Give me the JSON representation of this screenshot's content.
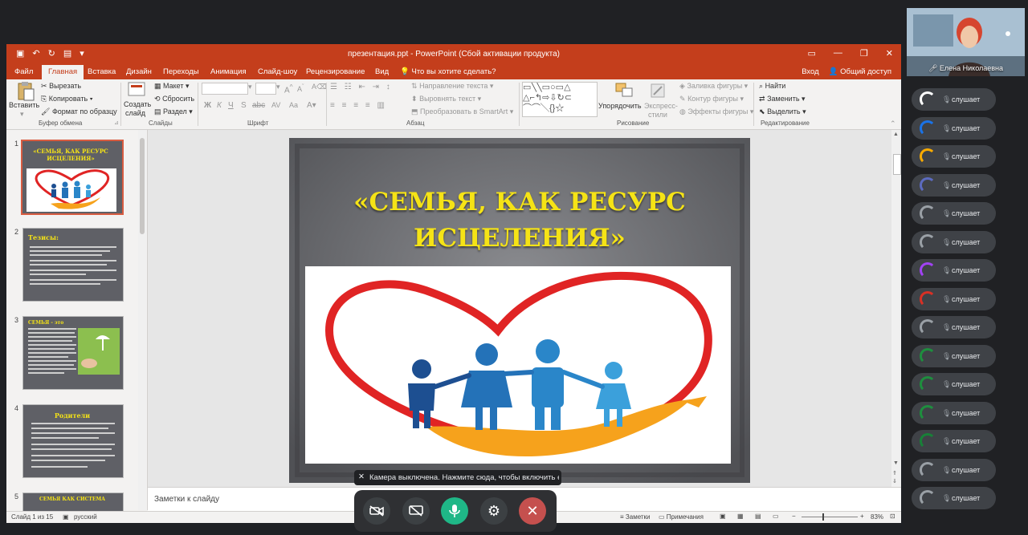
{
  "ppt": {
    "window_title": "презентация.ppt - PowerPoint (Сбой активации продукта)",
    "tabs": [
      "Файл",
      "Главная",
      "Вставка",
      "Дизайн",
      "Переходы",
      "Анимация",
      "Слайд-шоу",
      "Рецензирование",
      "Вид"
    ],
    "tell_me": "Что вы хотите сделать?",
    "sign_in": "Вход",
    "share": "Общий доступ",
    "ribbon": {
      "paste": "Вставить",
      "cut": "Вырезать",
      "copy": "Копировать",
      "format_painter": "Формат по образцу",
      "clipboard_group": "Буфер обмена",
      "new_slide_line1": "Создать",
      "new_slide_line2": "слайд",
      "layout": "Макет",
      "reset": "Сбросить",
      "section": "Раздел",
      "slides_group": "Слайды",
      "font_group": "Шрифт",
      "text_direction": "Направление текста",
      "align_text": "Выровнять текст",
      "smartart": "Преобразовать в SmartArt",
      "paragraph_group": "Абзац",
      "arrange": "Упорядочить",
      "quick_styles_line1": "Экспресс-",
      "quick_styles_line2": "стили",
      "shape_fill": "Заливка фигуры",
      "shape_outline": "Контур фигуры",
      "shape_effects": "Эффекты фигуры",
      "drawing_group": "Рисование",
      "find": "Найти",
      "replace": "Заменить",
      "select": "Выделить",
      "editing_group": "Редактирование"
    },
    "thumbnails": [
      {
        "num": "1",
        "title": "«СЕМЬЯ, КАК РЕСУРС ИСЦЕЛЕНИЯ»"
      },
      {
        "num": "2",
        "title": "Тезисы:"
      },
      {
        "num": "3",
        "title": "СЕМЬЯ - это"
      },
      {
        "num": "4",
        "title": "Родители"
      },
      {
        "num": "5",
        "title": "СЕМЬЯ КАК СИСТЕМА"
      }
    ],
    "slide": {
      "title_line1": "«СЕМЬЯ, КАК РЕСУРС",
      "title_line2": "ИСЦЕЛЕНИЯ»"
    },
    "notes_placeholder": "Заметки к слайду",
    "status": {
      "slide_count": "Слайд 1 из 15",
      "language": "русский",
      "notes": "Заметки",
      "comments": "Примечания",
      "zoom": "83%"
    }
  },
  "meeting": {
    "presenter_name": "Елена Николаевна",
    "participants": [
      {
        "status": "слушает",
        "color": "#ffffff"
      },
      {
        "status": "слушает",
        "color": "#1a73e8"
      },
      {
        "status": "слушает",
        "color": "#f9ab00"
      },
      {
        "status": "слушает",
        "color": "#5c6bc0"
      },
      {
        "status": "слушает",
        "color": "#9aa0a6"
      },
      {
        "status": "слушает",
        "color": "#9aa0a6"
      },
      {
        "status": "слушает",
        "color": "#a142f4"
      },
      {
        "status": "слушает",
        "color": "#d93025"
      },
      {
        "status": "слушает",
        "color": "#9aa0a6"
      },
      {
        "status": "слушает",
        "color": "#1e8e3e"
      },
      {
        "status": "слушает",
        "color": "#1e8e3e"
      },
      {
        "status": "слушает",
        "color": "#1e8e3e"
      },
      {
        "status": "слушает",
        "color": "#188038"
      },
      {
        "status": "слушает",
        "color": "#9aa0a6"
      },
      {
        "status": "слушает",
        "color": "#9aa0a6"
      }
    ],
    "camera_tooltip": "Камера выключена. Нажмите сюда, чтобы включить её"
  },
  "colors": {
    "ppt_accent": "#c43e1c",
    "slide_title": "#f5e316",
    "mic_active": "#1fb787",
    "leave": "#c5504e"
  }
}
